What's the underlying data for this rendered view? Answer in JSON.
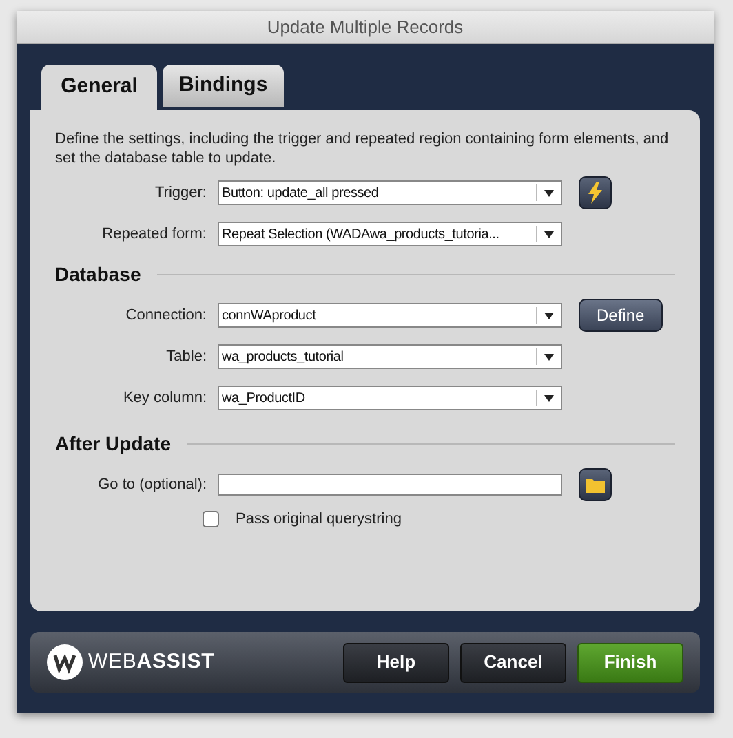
{
  "window": {
    "title": "Update Multiple Records"
  },
  "tabs": [
    {
      "label": "General",
      "selected": true
    },
    {
      "label": "Bindings",
      "selected": false
    }
  ],
  "description": "Define the settings, including the trigger and repeated region containing form elements, and set the database table to update.",
  "general_rows": [
    {
      "label": "Trigger:",
      "value": "Button: update_all pressed",
      "kind": "select",
      "side_button": {
        "kind": "lightning"
      }
    },
    {
      "label": "Repeated form:",
      "value": "Repeat Selection (WADAwa_products_tutoria...",
      "kind": "select"
    }
  ],
  "database": {
    "heading": "Database",
    "rows": [
      {
        "label": "Connection:",
        "value": "connWAproduct",
        "kind": "select",
        "side_button": {
          "kind": "define",
          "label": "Define"
        }
      },
      {
        "label": "Table:",
        "value": "wa_products_tutorial",
        "kind": "select"
      },
      {
        "label": "Key column:",
        "value": "wa_ProductID",
        "kind": "select"
      }
    ]
  },
  "after_update": {
    "heading": "After Update",
    "rows": [
      {
        "label": "Go to (optional):",
        "value": "",
        "kind": "text",
        "side_button": {
          "kind": "folder"
        }
      }
    ],
    "checkbox": {
      "label": "Pass original querystring",
      "checked": false
    }
  },
  "footer": {
    "logo": "WEB**ASSIST**",
    "buttons": [
      {
        "label": "Help",
        "kind": "normal"
      },
      {
        "label": "Cancel",
        "kind": "normal"
      },
      {
        "label": "Finish",
        "kind": "primary"
      }
    ]
  }
}
